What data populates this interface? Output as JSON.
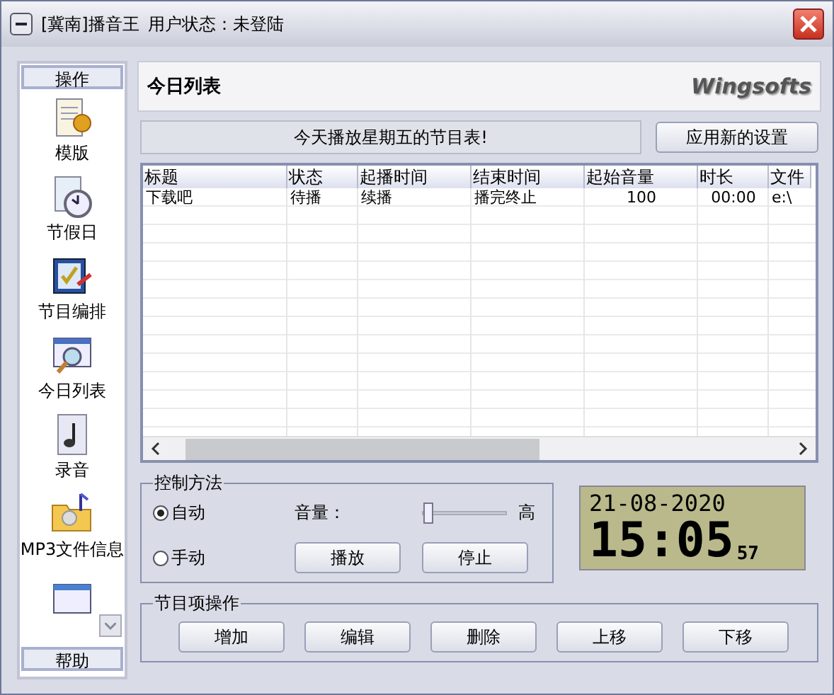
{
  "window": {
    "title": "[冀南]播音王",
    "user_status": "用户状态：未登陆"
  },
  "sidebar": {
    "header": "操作",
    "footer": "帮助",
    "items": [
      {
        "label": "模版",
        "kind": "notepad"
      },
      {
        "label": "节假日",
        "kind": "clock"
      },
      {
        "label": "节目编排",
        "kind": "check"
      },
      {
        "label": "今日列表",
        "kind": "magnifier"
      },
      {
        "label": "录音",
        "kind": "note"
      },
      {
        "label": "MP3文件信息",
        "kind": "folder"
      },
      {
        "kind": "window"
      }
    ]
  },
  "panel": {
    "title": "今日列表",
    "brand": "Wingsofts"
  },
  "notice": "今天播放星期五的节目表!",
  "apply_button": "应用新的设置",
  "table": {
    "columns": [
      "标题",
      "状态",
      "起播时间",
      "结束时间",
      "起始音量",
      "时长",
      "文件"
    ],
    "rows": [
      [
        "下载吧",
        "待播",
        "续播",
        "播完终止",
        "100",
        "00:00",
        "e:\\"
      ]
    ]
  },
  "control": {
    "title": "控制方法",
    "modes": [
      {
        "label": "自动",
        "selected": true
      },
      {
        "label": "手动",
        "selected": false
      }
    ],
    "volume_label": "音量：",
    "volume_high": "高",
    "volume": {
      "level": 0.02
    },
    "buttons": [
      "播放",
      "停止"
    ]
  },
  "clock": {
    "date": "21-08-2020",
    "time": "15:05",
    "seconds": "57"
  },
  "items_group": {
    "title": "节目项操作",
    "buttons": [
      "增加",
      "编辑",
      "删除",
      "上移",
      "下移"
    ]
  }
}
